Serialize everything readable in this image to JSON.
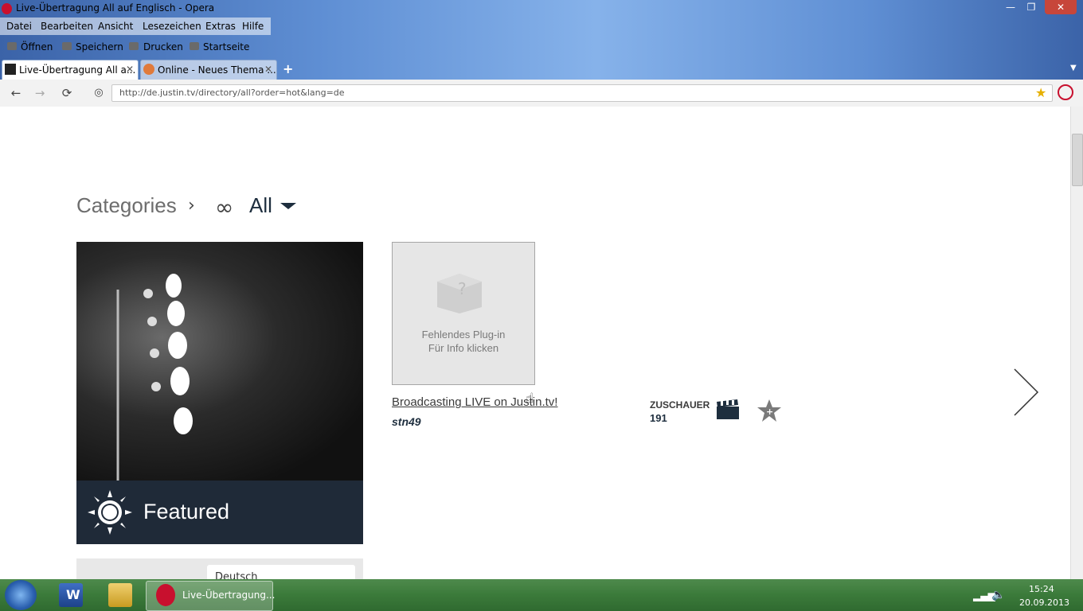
{
  "window": {
    "title": "Live-Übertragung All auf Englisch - Opera",
    "buttons": {
      "minimize": "—",
      "restore": "❐",
      "close": "✕"
    }
  },
  "menubar": {
    "items": [
      "Datei",
      "Bearbeiten",
      "Ansicht",
      "Lesezeichen",
      "Extras",
      "Hilfe"
    ]
  },
  "toolbar": {
    "items": [
      "Öffnen",
      "Speichern",
      "Drucken",
      "Startseite"
    ]
  },
  "tabs": [
    {
      "label": "Live-Übertragung All a...",
      "active": true
    },
    {
      "label": "Online - Neues Thema ...",
      "active": false
    }
  ],
  "address": {
    "url": "http://de.justin.tv/directory/all?order=hot&lang=de"
  },
  "page": {
    "categories_label": "Categories",
    "all_label": "All",
    "featured_label": "Featured",
    "plugin": {
      "line1": "Fehlendes Plug-in",
      "line2": "Für Info klicken"
    },
    "stream": {
      "title": "Broadcasting LIVE on Justin.tv!",
      "user": "stn49",
      "viewers_label": "ZUSCHAUER",
      "viewers_count": "191"
    },
    "lower_card_text": "Deutsch"
  },
  "taskbar": {
    "task_label": "Live-Übertragung...",
    "time": "15:24",
    "date": "20.09.2013"
  },
  "colors": {
    "accent_dark": "#1f2a38",
    "opera_red": "#c8102e"
  }
}
